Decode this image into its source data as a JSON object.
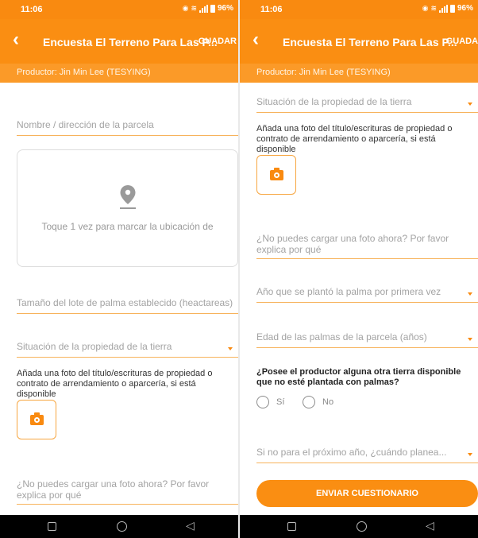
{
  "status_bar": {
    "time": "11:06",
    "battery": "96%"
  },
  "app_bar": {
    "title": "Encuesta El Terreno Para Las P...",
    "save_label": "GUADAR"
  },
  "producer": {
    "label": "Productor: Jin Min Lee (TESYING)"
  },
  "form": {
    "parcel_name_placeholder": "Nombre / dirección de la parcela",
    "map_prompt": "Toque 1 vez para marcar la ubicación de",
    "plot_size_placeholder": "Tamaño del lote de palma establecido (heactareas)",
    "land_tenure_placeholder": "Situación de la propiedad de la tierra",
    "photo_instruction": "Añada una foto del título/escrituras de propiedad o contrato de arrendamiento o aparcería, si está disponible",
    "no_photo_placeholder": "¿No puedes cargar una foto ahora? Por favor explica por qué",
    "year_planted_placeholder": "Año que se plantó la palma por primera vez",
    "palm_age_placeholder": "Edad de las palmas de la parcela (años)",
    "other_land_question": "¿Posee el productor alguna otra tierra disponible que no esté plantada con palmas?",
    "yes_label": "Sí",
    "no_label": "No",
    "plan_placeholder": "Si no para el próximo año, ¿cuándo planea...",
    "submit_label": "ENVIAR CUESTIONARIO"
  },
  "colors": {
    "accent": "#fa8e12",
    "producer_bar": "#fb9a28",
    "field_line": "#f7b35c"
  }
}
